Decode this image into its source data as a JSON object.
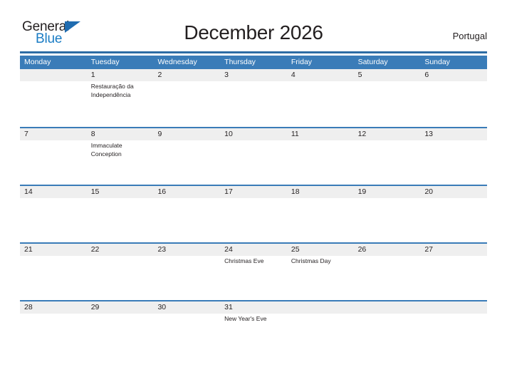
{
  "logo": {
    "word_top": "General",
    "word_bottom": "Blue",
    "flag_icon": "triangle-flag-icon",
    "brand_color": "#1a7cc4",
    "flag_color": "#1f6cb0"
  },
  "header": {
    "title": "December 2026",
    "region": "Portugal",
    "rule_color": "#2e6da4"
  },
  "calendar": {
    "header_background": "#3a7cb8",
    "date_band_background": "#efefef",
    "weekdays": [
      "Monday",
      "Tuesday",
      "Wednesday",
      "Thursday",
      "Friday",
      "Saturday",
      "Sunday"
    ],
    "weeks": [
      {
        "days": [
          {
            "date": "",
            "event": ""
          },
          {
            "date": "1",
            "event": "Restauração da Independência"
          },
          {
            "date": "2",
            "event": ""
          },
          {
            "date": "3",
            "event": ""
          },
          {
            "date": "4",
            "event": ""
          },
          {
            "date": "5",
            "event": ""
          },
          {
            "date": "6",
            "event": ""
          }
        ]
      },
      {
        "days": [
          {
            "date": "7",
            "event": ""
          },
          {
            "date": "8",
            "event": "Immaculate Conception"
          },
          {
            "date": "9",
            "event": ""
          },
          {
            "date": "10",
            "event": ""
          },
          {
            "date": "11",
            "event": ""
          },
          {
            "date": "12",
            "event": ""
          },
          {
            "date": "13",
            "event": ""
          }
        ]
      },
      {
        "days": [
          {
            "date": "14",
            "event": ""
          },
          {
            "date": "15",
            "event": ""
          },
          {
            "date": "16",
            "event": ""
          },
          {
            "date": "17",
            "event": ""
          },
          {
            "date": "18",
            "event": ""
          },
          {
            "date": "19",
            "event": ""
          },
          {
            "date": "20",
            "event": ""
          }
        ]
      },
      {
        "days": [
          {
            "date": "21",
            "event": ""
          },
          {
            "date": "22",
            "event": ""
          },
          {
            "date": "23",
            "event": ""
          },
          {
            "date": "24",
            "event": "Christmas Eve"
          },
          {
            "date": "25",
            "event": "Christmas Day"
          },
          {
            "date": "26",
            "event": ""
          },
          {
            "date": "27",
            "event": ""
          }
        ]
      },
      {
        "days": [
          {
            "date": "28",
            "event": ""
          },
          {
            "date": "29",
            "event": ""
          },
          {
            "date": "30",
            "event": ""
          },
          {
            "date": "31",
            "event": "New Year's Eve"
          },
          {
            "date": "",
            "event": ""
          },
          {
            "date": "",
            "event": ""
          },
          {
            "date": "",
            "event": ""
          }
        ]
      }
    ]
  }
}
